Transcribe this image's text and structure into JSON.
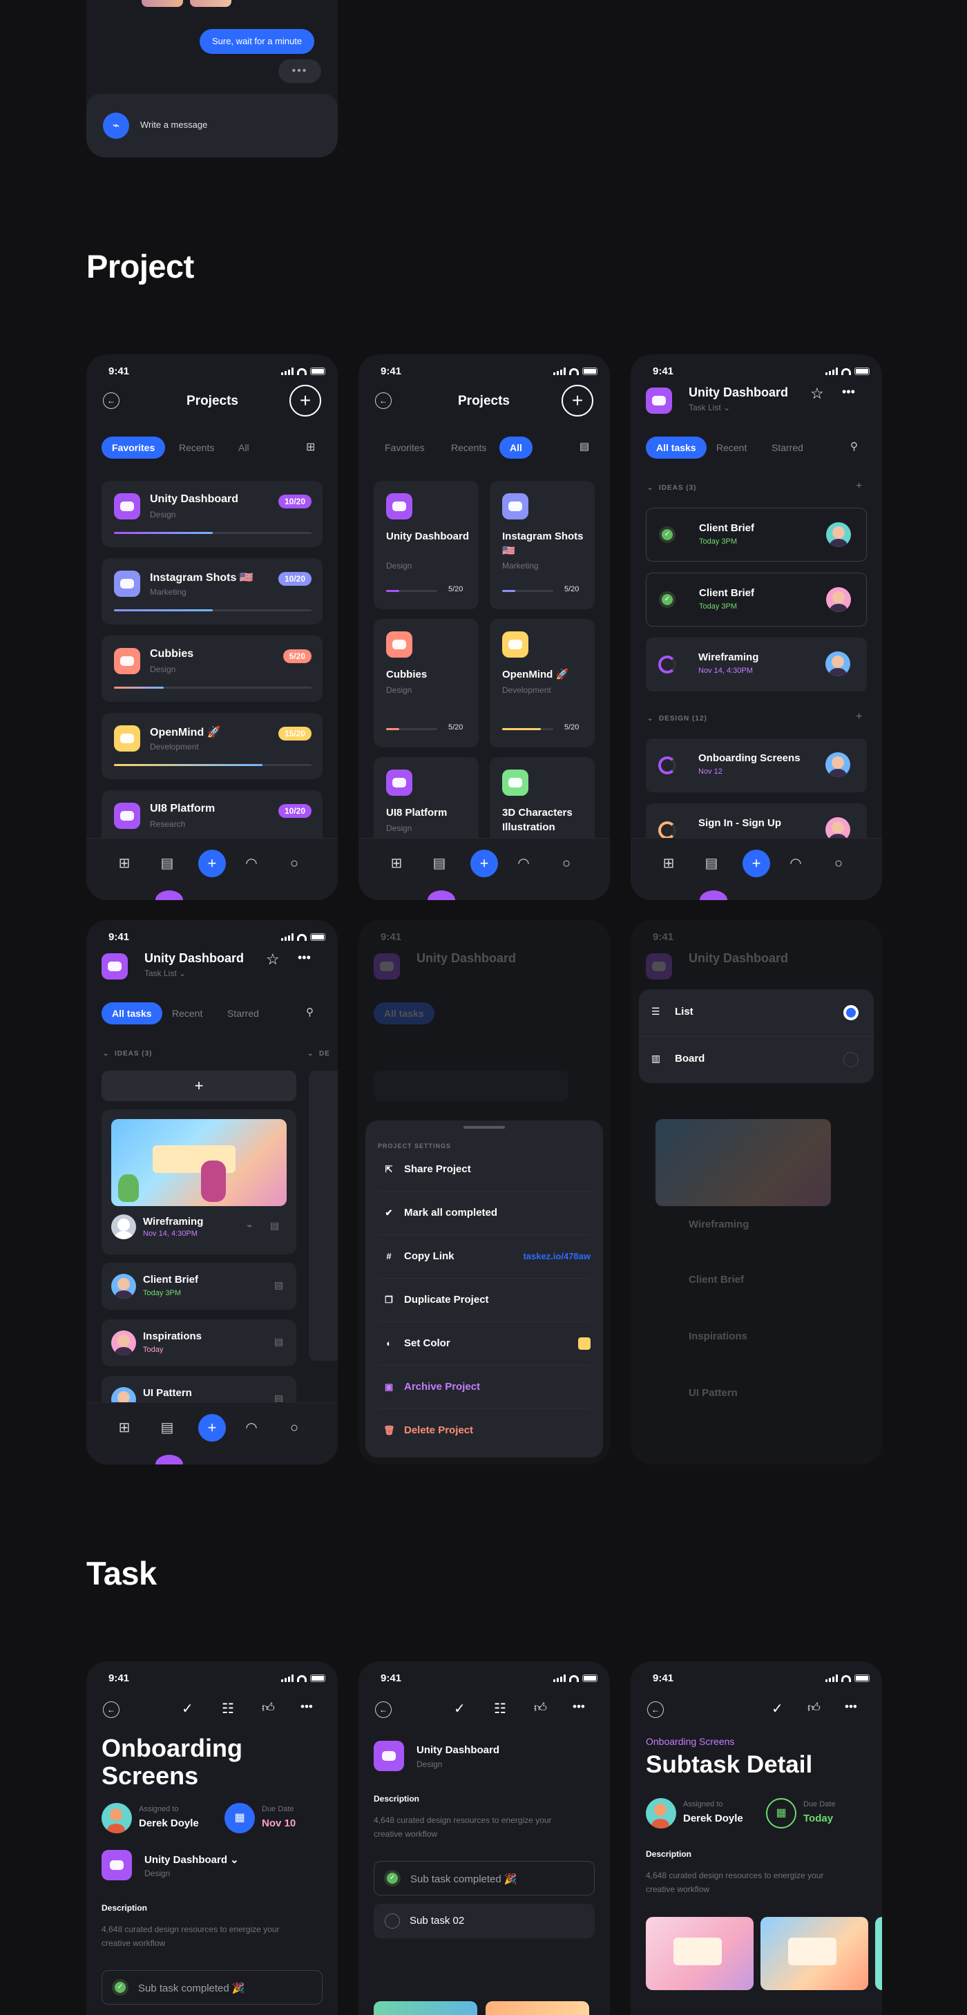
{
  "chat": {
    "bubble_text": "Sure, wait for a minute",
    "typing": "•••",
    "input_placeholder": "Write a message"
  },
  "sections": {
    "project": "Project",
    "task": "Task"
  },
  "status": {
    "time": "9:41"
  },
  "projects_list": {
    "title": "Projects",
    "tabs": [
      "Favorites",
      "Recents",
      "All"
    ],
    "items": [
      {
        "name": "Unity Dashboard",
        "cat": "Design",
        "badge": "10/20",
        "color": "#a855f7",
        "badge_color": "#a855f7",
        "progress": 0.5
      },
      {
        "name": "Instagram Shots 🇺🇸",
        "cat": "Marketing",
        "badge": "10/20",
        "color": "#8b93f8",
        "badge_color": "#8b93f8",
        "progress": 0.5
      },
      {
        "name": "Cubbies",
        "cat": "Design",
        "badge": "5/20",
        "color": "#ff8d7a",
        "badge_color": "#ff8d7a",
        "progress": 0.25
      },
      {
        "name": "OpenMind 🚀",
        "cat": "Development",
        "badge": "15/20",
        "color": "#ffd466",
        "badge_color": "#ffd466",
        "progress": 0.75
      },
      {
        "name": "UI8 Platform",
        "cat": "Research",
        "badge": "10/20",
        "color": "#a855f7",
        "badge_color": "#a855f7",
        "progress": 0.5
      }
    ]
  },
  "projects_grid": {
    "title": "Projects",
    "tabs": [
      "Favorites",
      "Recents",
      "All"
    ],
    "items": [
      {
        "name": "Unity Dashboard",
        "cat": "Design",
        "count": "5/20",
        "color": "#a855f7",
        "progress": 0.25
      },
      {
        "name": "Instagram Shots 🇺🇸",
        "cat": "Marketing",
        "count": "5/20",
        "color": "#8b93f8",
        "progress": 0.25
      },
      {
        "name": "Cubbies",
        "cat": "Design",
        "count": "5/20",
        "color": "#ff8d7a",
        "progress": 0.25
      },
      {
        "name": "OpenMind 🚀",
        "cat": "Development",
        "count": "5/20",
        "color": "#ffd466",
        "progress": 0.75
      },
      {
        "name": "UI8 Platform",
        "cat": "Design",
        "count": "",
        "color": "#a855f7",
        "progress": 0
      },
      {
        "name": "3D Characters Illustration",
        "cat": "",
        "count": "",
        "color": "#7de38a",
        "progress": 0
      }
    ]
  },
  "task_list": {
    "title": "Unity Dashboard",
    "subtitle": "Task List",
    "tabs": [
      "All tasks",
      "Recent",
      "Starred"
    ],
    "group_ideas": "IDEAS (3)",
    "group_design": "DESIGN (12)",
    "ideas": [
      {
        "name": "Client Brief",
        "when": "Today 3PM",
        "done": true
      },
      {
        "name": "Client Brief",
        "when": "Today 3PM",
        "done": true
      },
      {
        "name": "Wireframing",
        "when": "Nov 14, 4:30PM",
        "done": false
      }
    ],
    "design": [
      {
        "name": "Onboarding Screens",
        "when": "Nov 12"
      },
      {
        "name": "Sign In - Sign Up",
        "when": ""
      }
    ]
  },
  "board": {
    "title": "Unity Dashboard",
    "subtitle": "Task List",
    "tabs": [
      "All tasks",
      "Recent",
      "Starred"
    ],
    "group": "IDEAS (3)",
    "group2": "DE",
    "cards": [
      {
        "name": "Wireframing",
        "when": "Nov 14, 4:30PM"
      },
      {
        "name": "Client Brief",
        "when": "Today 3PM"
      },
      {
        "name": "Inspirations",
        "when": "Today"
      },
      {
        "name": "UI Pattern",
        "when": ""
      }
    ]
  },
  "settings_sheet": {
    "header": "PROJECT SETTINGS",
    "items": [
      {
        "label": "Share Project",
        "icon": "share-icon"
      },
      {
        "label": "Mark all completed",
        "icon": "check-circle-icon"
      },
      {
        "label": "Copy Link",
        "icon": "hash-icon",
        "value": "taskez.io/478aw"
      },
      {
        "label": "Duplicate Project",
        "icon": "duplicate-icon"
      },
      {
        "label": "Set Color",
        "icon": "color-icon"
      },
      {
        "label": "Archive Project",
        "icon": "archive-icon"
      },
      {
        "label": "Delete Project",
        "icon": "trash-icon"
      }
    ],
    "colors": {
      "archive": "#c77dff",
      "delete": "#ff8d7a",
      "link": "#2d6bff",
      "swatch": "#ffd466"
    }
  },
  "view_menu": {
    "items": [
      "List",
      "Board"
    ]
  },
  "task_detail": {
    "title_line1": "Onboarding",
    "title_line2": "Screens",
    "assigned_label": "Assigned to",
    "assignee": "Derek Doyle",
    "due_label": "Due Date",
    "due": "Nov 10",
    "project": "Unity Dashboard",
    "project_cat": "Design",
    "desc_label": "Description",
    "desc": "4,648 curated design resources to energize your creative workflow",
    "subtask": "Sub task completed 🎉"
  },
  "task_subtasks": {
    "project": "Unity Dashboard",
    "project_cat": "Design",
    "desc_label": "Description",
    "desc": "4,648 curated design resources to energize your creative workflow",
    "subtasks": [
      "Sub task completed 🎉",
      "Sub task 02"
    ]
  },
  "subtask_detail": {
    "crumb": "Onboarding Screens",
    "title": "Subtask Detail",
    "assigned_label": "Assigned to",
    "assignee": "Derek Doyle",
    "due_label": "Due Date",
    "due": "Today",
    "desc_label": "Description",
    "desc": "4,648 curated design resources to energize your creative workflow"
  }
}
